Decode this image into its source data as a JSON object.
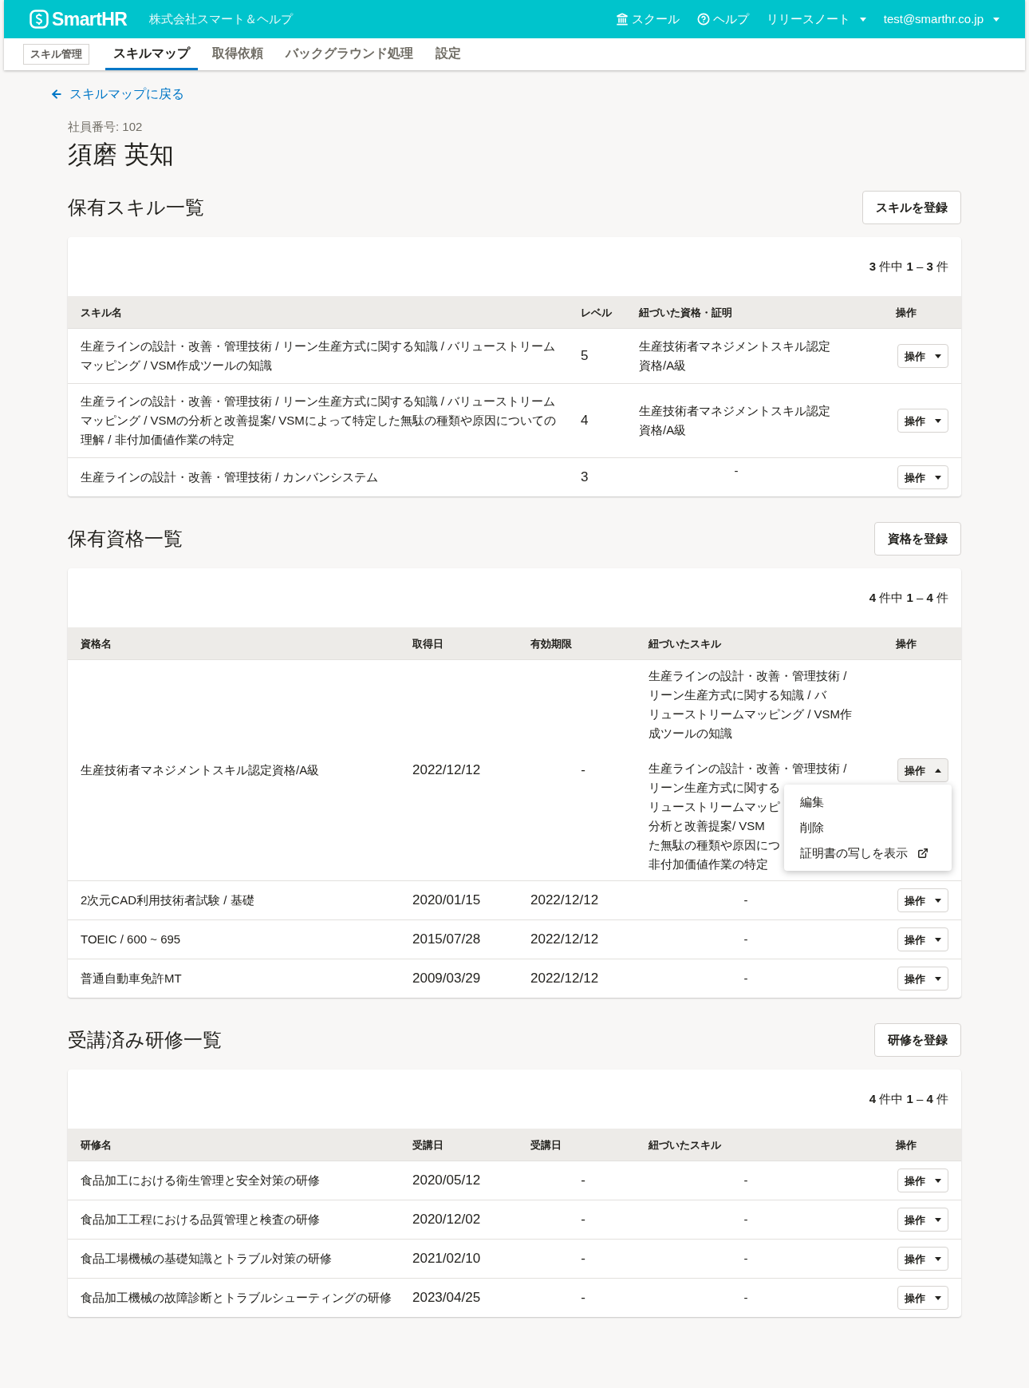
{
  "header": {
    "logo": "SmartHR",
    "company": "株式会社スマート＆ヘルプ",
    "links": [
      {
        "label": "スクール",
        "kind": "school"
      },
      {
        "label": "ヘルプ",
        "kind": "help"
      },
      {
        "label": "リリースノート",
        "kind": "dropdown"
      },
      {
        "label": "test@smarthr.co.jp",
        "kind": "dropdown"
      }
    ]
  },
  "app_badge": "スキル管理",
  "tabs": [
    {
      "label": "スキルマップ",
      "selected": true
    },
    {
      "label": "取得依頼",
      "selected": false
    },
    {
      "label": "バックグラウンド処理",
      "selected": false
    },
    {
      "label": "設定",
      "selected": false
    }
  ],
  "back_link": "スキルマップに戻る",
  "employee_number": "社員番号: 102",
  "employee_name": "須磨 英知",
  "sections": [
    {
      "title": "保有スキル一覧",
      "button": "スキルを登録",
      "count": "**3** 件中 **1** – **3** 件",
      "columns": [
        {
          "label": "スキル名",
          "kind": "text"
        },
        {
          "label": "レベル",
          "kind": "level"
        },
        {
          "label": "紐づいた資格・証明",
          "kind": "linked"
        },
        {
          "label": "操作",
          "kind": "action"
        }
      ],
      "rows": [
        {
          "cells": [
            {
              "text": "生産ラインの設計・改善・管理技術 / リーン生産方式に関する知識 / バリューストリームマッピング / VSM作成ツールの知識"
            },
            {
              "text": "5"
            },
            {
              "text": "生産技術者マネジメントスキル認定資格/A級"
            },
            {
              "text": "操作"
            }
          ],
          "menu_open": false
        },
        {
          "cells": [
            {
              "text": "生産ラインの設計・改善・管理技術 / リーン生産方式に関する知識 / バリューストリームマッピング / VSMの分析と改善提案/ VSMによって特定した無駄の種類や原因についての理解 / 非付加価値作業の特定"
            },
            {
              "text": "4"
            },
            {
              "text": "生産技術者マネジメントスキル認定資格/A級"
            },
            {
              "text": "操作"
            }
          ],
          "menu_open": false
        },
        {
          "cells": [
            {
              "text": "生産ラインの設計・改善・管理技術 / カンバンシステム"
            },
            {
              "text": "3"
            },
            {
              "text": "-"
            },
            {
              "text": "操作"
            }
          ],
          "menu_open": false
        }
      ]
    },
    {
      "title": "保有資格一覧",
      "button": "資格を登録",
      "count": "**4** 件中 **1** – **4** 件",
      "columns": [
        {
          "label": "資格名",
          "kind": "text"
        },
        {
          "label": "取得日",
          "kind": "date"
        },
        {
          "label": "有効期限",
          "kind": "date"
        },
        {
          "label": "紐づいたスキル",
          "kind": "skills"
        },
        {
          "label": "操作",
          "kind": "action"
        }
      ],
      "rows": [
        {
          "cells": [
            {
              "text": "生産技術者マネジメントスキル認定資格/A級"
            },
            {
              "text": "2022/12/12"
            },
            {
              "text": "-"
            },
            {
              "blocks": [
                [
                  "生産ラインの設計・改善・管理技術 /",
                  "リーン生産方式に関する知識 / バ",
                  "リューストリームマッピング / VSM作",
                  "成ツールの知識"
                ],
                [
                  "生産ラインの設計・改善・管理技術 /",
                  "リーン生産方式に関する",
                  "リューストリームマッピ",
                  "分析と改善提案/ VSM",
                  "た無駄の種類や原因につ",
                  "非付加価値作業の特定"
                ]
              ]
            },
            {
              "text": "操作"
            }
          ],
          "menu_open": true,
          "menu": [
            {
              "label": "編集",
              "external": false
            },
            {
              "label": "削除",
              "external": false
            },
            {
              "label": "証明書の写しを表示",
              "external": true
            }
          ]
        },
        {
          "cells": [
            {
              "text": "2次元CAD利用技術者試験 / 基礎"
            },
            {
              "text": "2020/01/15"
            },
            {
              "text": "2022/12/12"
            },
            {
              "text": "-"
            },
            {
              "text": "操作"
            }
          ],
          "menu_open": false
        },
        {
          "cells": [
            {
              "text": "TOEIC / 600 ~ 695"
            },
            {
              "text": "2015/07/28"
            },
            {
              "text": "2022/12/12"
            },
            {
              "text": "-"
            },
            {
              "text": "操作"
            }
          ],
          "menu_open": false
        },
        {
          "cells": [
            {
              "text": "普通自動車免許MT"
            },
            {
              "text": "2009/03/29"
            },
            {
              "text": "2022/12/12"
            },
            {
              "text": "-"
            },
            {
              "text": "操作"
            }
          ],
          "menu_open": false
        }
      ]
    },
    {
      "title": "受講済み研修一覧",
      "button": "研修を登録",
      "count": "**4** 件中 **1** – **4** 件",
      "columns": [
        {
          "label": "研修名",
          "kind": "text"
        },
        {
          "label": "受講日",
          "kind": "date"
        },
        {
          "label": "受講日",
          "kind": "date"
        },
        {
          "label": "紐づいたスキル",
          "kind": "skills"
        },
        {
          "label": "操作",
          "kind": "action"
        }
      ],
      "rows": [
        {
          "cells": [
            {
              "text": "食品加工における衛生管理と安全対策の研修"
            },
            {
              "text": "2020/05/12"
            },
            {
              "text": "-"
            },
            {
              "text": "-"
            },
            {
              "text": "操作"
            }
          ],
          "menu_open": false
        },
        {
          "cells": [
            {
              "text": "食品加工工程における品質管理と検査の研修"
            },
            {
              "text": "2020/12/02"
            },
            {
              "text": "-"
            },
            {
              "text": "-"
            },
            {
              "text": "操作"
            }
          ],
          "menu_open": false
        },
        {
          "cells": [
            {
              "text": "食品工場機械の基礎知識とトラブル対策の研修"
            },
            {
              "text": "2021/02/10"
            },
            {
              "text": "-"
            },
            {
              "text": "-"
            },
            {
              "text": "操作"
            }
          ],
          "menu_open": false
        },
        {
          "cells": [
            {
              "text": "食品加工機械の故障診断とトラブルシューティングの研修"
            },
            {
              "text": "2023/04/25"
            },
            {
              "text": "-"
            },
            {
              "text": "-"
            },
            {
              "text": "操作"
            }
          ],
          "menu_open": false
        }
      ]
    }
  ]
}
